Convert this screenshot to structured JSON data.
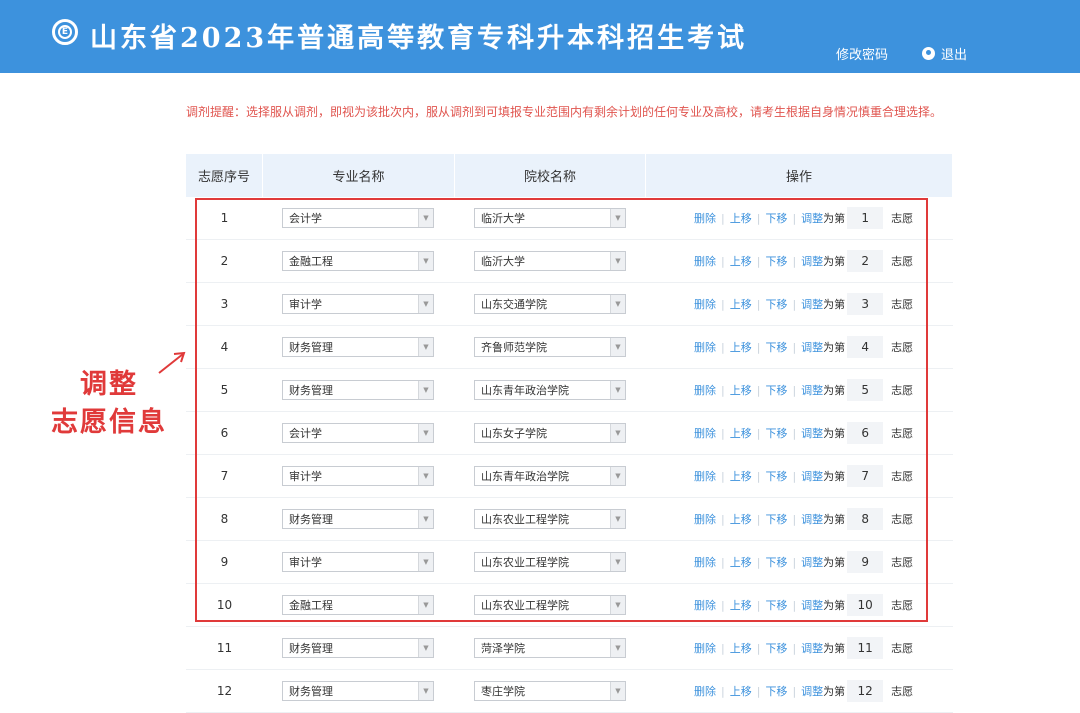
{
  "header": {
    "title": "山东省2023年普通高等教育专科升本科招生考试",
    "logo_letter": "E",
    "change_password": "修改密码",
    "logout": "退出",
    "bg_color": "#3d92dd"
  },
  "notice": "调剂提醒：选择服从调剂，即视为该批次内，服从调剂到可填报专业范围内有剩余计划的任何专业及高校，请考生根据自身情况慎重合理选择。",
  "table": {
    "headers": [
      "志愿序号",
      "专业名称",
      "院校名称",
      "操作"
    ],
    "ops": {
      "delete": "删除",
      "up": "上移",
      "down": "下移",
      "adjust": "调整",
      "to": "为第",
      "suffix": "志愿"
    },
    "rows": [
      {
        "seq": "1",
        "major": "会计学",
        "school": "临沂大学",
        "rank": "1"
      },
      {
        "seq": "2",
        "major": "金融工程",
        "school": "临沂大学",
        "rank": "2"
      },
      {
        "seq": "3",
        "major": "审计学",
        "school": "山东交通学院",
        "rank": "3"
      },
      {
        "seq": "4",
        "major": "财务管理",
        "school": "齐鲁师范学院",
        "rank": "4"
      },
      {
        "seq": "5",
        "major": "财务管理",
        "school": "山东青年政治学院",
        "rank": "5"
      },
      {
        "seq": "6",
        "major": "会计学",
        "school": "山东女子学院",
        "rank": "6"
      },
      {
        "seq": "7",
        "major": "审计学",
        "school": "山东青年政治学院",
        "rank": "7"
      },
      {
        "seq": "8",
        "major": "财务管理",
        "school": "山东农业工程学院",
        "rank": "8"
      },
      {
        "seq": "9",
        "major": "审计学",
        "school": "山东农业工程学院",
        "rank": "9"
      },
      {
        "seq": "10",
        "major": "金融工程",
        "school": "山东农业工程学院",
        "rank": "10"
      },
      {
        "seq": "11",
        "major": "财务管理",
        "school": "菏泽学院",
        "rank": "11"
      },
      {
        "seq": "12",
        "major": "财务管理",
        "school": "枣庄学院",
        "rank": "12"
      }
    ]
  },
  "annotation": {
    "line1": "调整",
    "line2": "志愿信息",
    "color": "#e03a3a"
  }
}
